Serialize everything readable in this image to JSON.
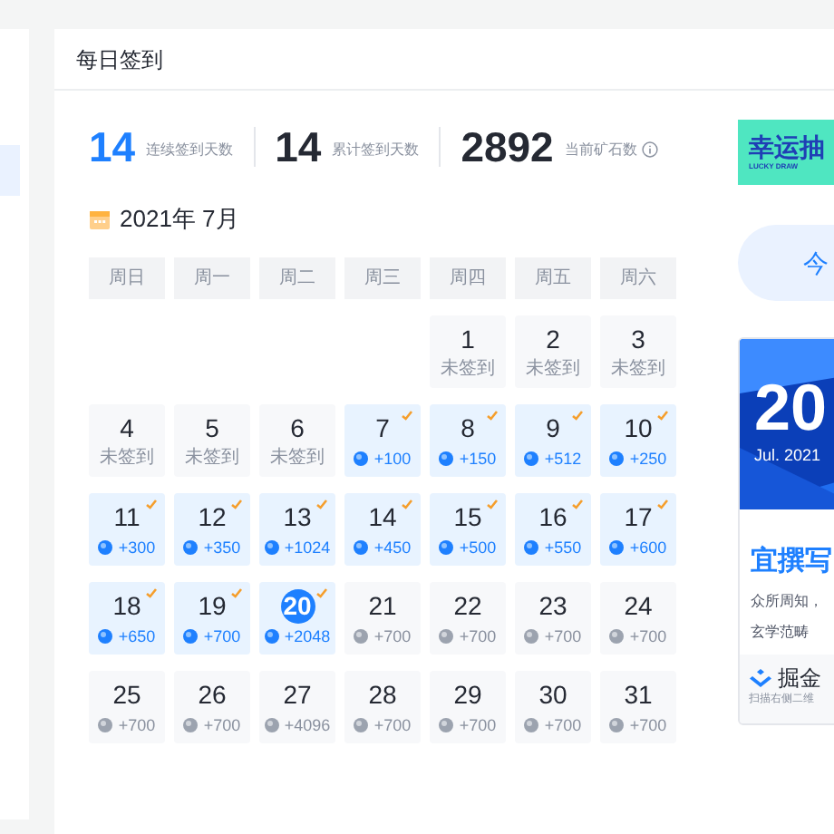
{
  "card_title": "每日签到",
  "stats": [
    {
      "value": "14",
      "label": "连续签到天数",
      "kind": "highlight"
    },
    {
      "value": "14",
      "label": "累计签到天数",
      "kind": "plain"
    },
    {
      "value": "2892",
      "label": "当前矿石数",
      "kind": "info"
    }
  ],
  "calendar": {
    "title": "2021年 7月",
    "weekdays": [
      "周日",
      "周一",
      "周二",
      "周三",
      "周四",
      "周五",
      "周六"
    ],
    "days": [
      {
        "kind": "blank"
      },
      {
        "kind": "blank"
      },
      {
        "kind": "blank"
      },
      {
        "kind": "blank"
      },
      {
        "day": "1",
        "kind": "missed",
        "note": "未签到",
        "checked": false,
        "today": false
      },
      {
        "day": "2",
        "kind": "missed",
        "note": "未签到",
        "checked": false,
        "today": false
      },
      {
        "day": "3",
        "kind": "missed",
        "note": "未签到",
        "checked": false,
        "today": false
      },
      {
        "day": "4",
        "kind": "missed",
        "note": "未签到",
        "checked": false,
        "today": false
      },
      {
        "day": "5",
        "kind": "missed",
        "note": "未签到",
        "checked": false,
        "today": false
      },
      {
        "day": "6",
        "kind": "missed",
        "note": "未签到",
        "checked": false,
        "today": false
      },
      {
        "day": "7",
        "kind": "reward",
        "note": "+100",
        "checked": true,
        "today": false
      },
      {
        "day": "8",
        "kind": "reward",
        "note": "+150",
        "checked": true,
        "today": false
      },
      {
        "day": "9",
        "kind": "reward",
        "note": "+512",
        "checked": true,
        "today": false
      },
      {
        "day": "10",
        "kind": "reward",
        "note": "+250",
        "checked": true,
        "today": false
      },
      {
        "day": "11",
        "kind": "reward",
        "note": "+300",
        "checked": true,
        "today": false
      },
      {
        "day": "12",
        "kind": "reward",
        "note": "+350",
        "checked": true,
        "today": false
      },
      {
        "day": "13",
        "kind": "reward",
        "note": "+1024",
        "checked": true,
        "today": false
      },
      {
        "day": "14",
        "kind": "reward",
        "note": "+450",
        "checked": true,
        "today": false
      },
      {
        "day": "15",
        "kind": "reward",
        "note": "+500",
        "checked": true,
        "today": false
      },
      {
        "day": "16",
        "kind": "reward",
        "note": "+550",
        "checked": true,
        "today": false
      },
      {
        "day": "17",
        "kind": "reward",
        "note": "+600",
        "checked": true,
        "today": false
      },
      {
        "day": "18",
        "kind": "reward",
        "note": "+650",
        "checked": true,
        "today": false
      },
      {
        "day": "19",
        "kind": "reward",
        "note": "+700",
        "checked": true,
        "today": false
      },
      {
        "day": "20",
        "kind": "reward",
        "note": "+2048",
        "checked": true,
        "today": true
      },
      {
        "day": "21",
        "kind": "upcoming",
        "note": "+700",
        "checked": false,
        "today": false
      },
      {
        "day": "22",
        "kind": "upcoming",
        "note": "+700",
        "checked": false,
        "today": false
      },
      {
        "day": "23",
        "kind": "upcoming",
        "note": "+700",
        "checked": false,
        "today": false
      },
      {
        "day": "24",
        "kind": "upcoming",
        "note": "+700",
        "checked": false,
        "today": false
      },
      {
        "day": "25",
        "kind": "upcoming",
        "note": "+700",
        "checked": false,
        "today": false
      },
      {
        "day": "26",
        "kind": "upcoming",
        "note": "+700",
        "checked": false,
        "today": false
      },
      {
        "day": "27",
        "kind": "upcoming",
        "note": "+4096",
        "checked": false,
        "today": false
      },
      {
        "day": "28",
        "kind": "upcoming",
        "note": "+700",
        "checked": false,
        "today": false
      },
      {
        "day": "29",
        "kind": "upcoming",
        "note": "+700",
        "checked": false,
        "today": false
      },
      {
        "day": "30",
        "kind": "upcoming",
        "note": "+700",
        "checked": false,
        "today": false
      },
      {
        "day": "31",
        "kind": "upcoming",
        "note": "+700",
        "checked": false,
        "today": false
      }
    ]
  },
  "lucky_draw": {
    "title": "幸运抽",
    "subtitle": "LUCKY DRAW"
  },
  "sign_button": "今",
  "daily_card": {
    "date": "20",
    "month": "Jul. 2021",
    "heading": "宜撰写",
    "lines": [
      "众所周知，",
      "玄学范畴"
    ],
    "brand": "掘金",
    "footer": "扫描右侧二维"
  }
}
